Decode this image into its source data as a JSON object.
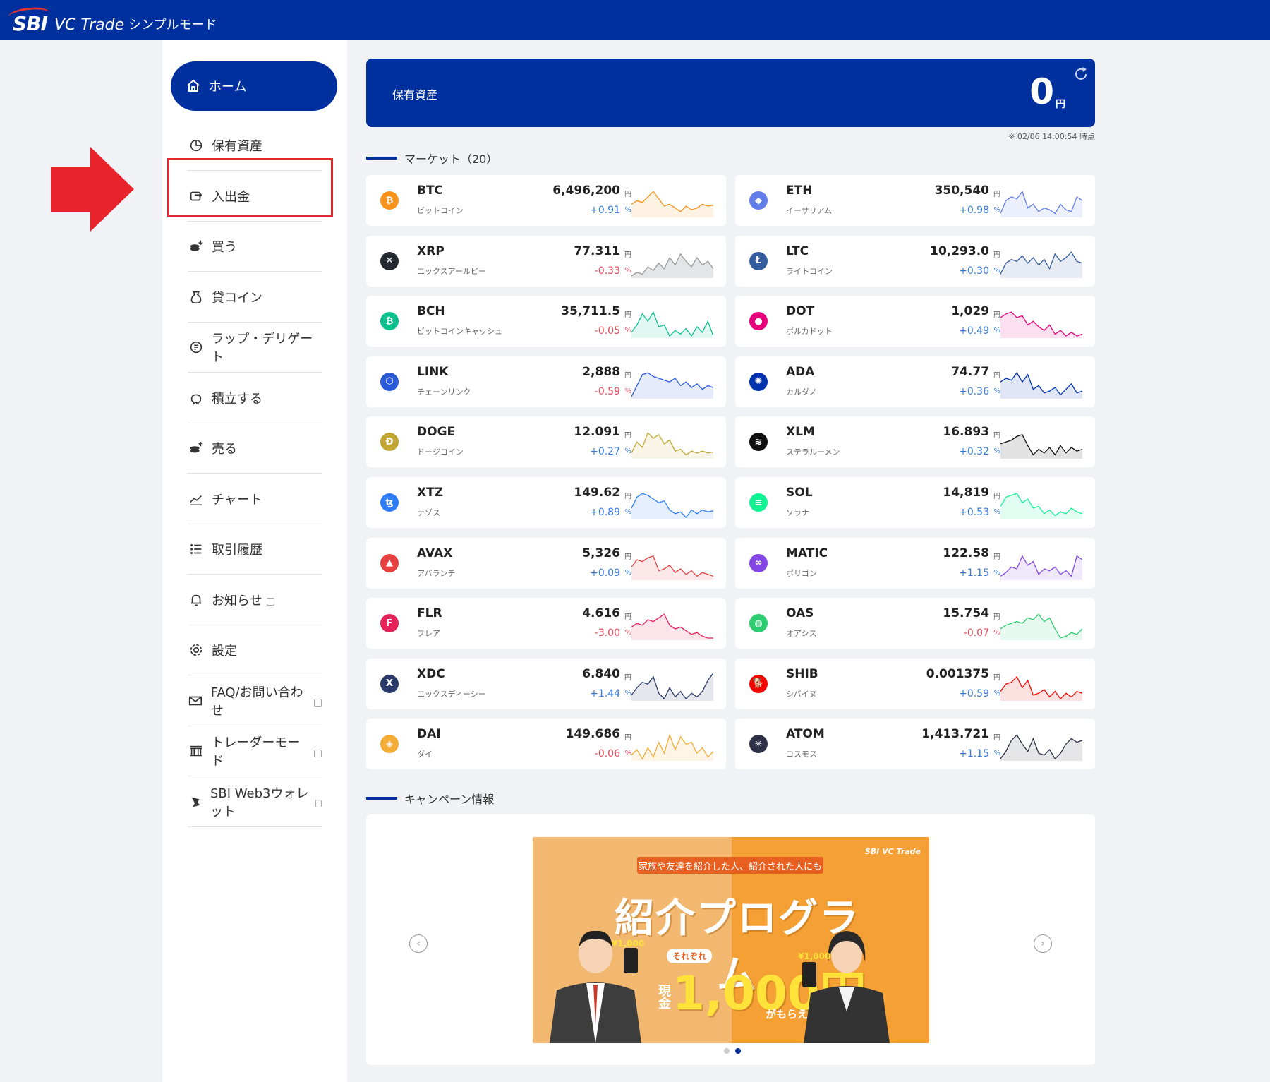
{
  "header": {
    "logo_sbi": "SBI",
    "logo_vc": "VC Trade",
    "mode": "シンプルモード"
  },
  "nav": {
    "home": "ホーム",
    "items": [
      {
        "label": "保有資産",
        "icon": "pie-chart-icon",
        "external": false
      },
      {
        "label": "入出金",
        "icon": "transfer-icon",
        "external": false
      },
      {
        "label": "買う",
        "icon": "buy-coins-icon",
        "external": false
      },
      {
        "label": "貸コイン",
        "icon": "money-bag-icon",
        "external": false
      },
      {
        "label": "ラップ・デリゲート",
        "icon": "wrap-icon",
        "external": false
      },
      {
        "label": "積立する",
        "icon": "piggy-bank-icon",
        "external": false
      },
      {
        "label": "売る",
        "icon": "sell-coins-icon",
        "external": false
      },
      {
        "label": "チャート",
        "icon": "line-chart-icon",
        "external": false
      },
      {
        "label": "取引履歴",
        "icon": "list-icon",
        "external": false
      },
      {
        "label": "お知らせ",
        "icon": "bell-icon",
        "external": true
      },
      {
        "label": "設定",
        "icon": "gear-icon",
        "external": false
      },
      {
        "label": "FAQ/お問い合わせ",
        "icon": "mail-icon",
        "external": true
      },
      {
        "label": "トレーダーモード",
        "icon": "bank-icon",
        "external": true
      },
      {
        "label": "SBI Web3ウォレット",
        "icon": "wallet-icon",
        "external": true
      }
    ]
  },
  "assets": {
    "label": "保有資産",
    "value": "0",
    "unit": "円",
    "timestamp": "※ 02/06 14:00:54 時点"
  },
  "market": {
    "title": "マーケット（20）"
  },
  "coins": [
    {
      "sym": "BTC",
      "name": "ビットコイン",
      "price": "6,496,200",
      "chg": "+0.91",
      "dir": "up",
      "color": "#f7931a",
      "glyph": "₿",
      "spark": [
        18,
        14,
        16,
        10,
        4,
        12,
        20,
        18,
        22,
        26,
        20,
        24,
        22,
        18,
        20,
        19
      ]
    },
    {
      "sym": "ETH",
      "name": "イーサリアム",
      "price": "350,540",
      "chg": "+0.98",
      "dir": "up",
      "color": "#627eea",
      "glyph": "◆",
      "spark": [
        28,
        14,
        10,
        12,
        4,
        22,
        18,
        26,
        22,
        24,
        28,
        18,
        24,
        26,
        10,
        14
      ]
    },
    {
      "sym": "XRP",
      "name": "エックスアールピー",
      "price": "77.311",
      "chg": "-0.33",
      "dir": "down",
      "color": "#23292f",
      "glyph": "✕",
      "spark": [
        30,
        26,
        28,
        20,
        24,
        16,
        22,
        10,
        18,
        6,
        14,
        20,
        10,
        18,
        14,
        22
      ]
    },
    {
      "sym": "LTC",
      "name": "ライトコイン",
      "price": "10,293.0",
      "chg": "+0.30",
      "dir": "up",
      "color": "#345d9d",
      "glyph": "Ł",
      "spark": [
        28,
        16,
        12,
        14,
        8,
        16,
        10,
        18,
        12,
        22,
        6,
        14,
        10,
        4,
        14,
        16
      ]
    },
    {
      "sym": "BCH",
      "name": "ビットコインキャッシュ",
      "price": "35,711.5",
      "chg": "-0.05",
      "dir": "down",
      "color": "#0ac18e",
      "glyph": "₿",
      "spark": [
        26,
        18,
        6,
        14,
        4,
        20,
        18,
        30,
        24,
        28,
        22,
        30,
        20,
        26,
        14,
        30
      ]
    },
    {
      "sym": "DOT",
      "name": "ポルカドット",
      "price": "1,029",
      "chg": "+0.49",
      "dir": "up",
      "color": "#e6007a",
      "glyph": "●",
      "spark": [
        10,
        6,
        4,
        10,
        8,
        18,
        14,
        20,
        24,
        18,
        28,
        24,
        30,
        26,
        30,
        28
      ]
    },
    {
      "sym": "LINK",
      "name": "チェーンリンク",
      "price": "2,888",
      "chg": "-0.59",
      "dir": "down",
      "color": "#2a5ada",
      "glyph": "⬡",
      "spark": [
        30,
        18,
        6,
        4,
        8,
        10,
        12,
        14,
        10,
        18,
        14,
        20,
        16,
        22,
        18,
        20
      ]
    },
    {
      "sym": "ADA",
      "name": "カルダノ",
      "price": "74.77",
      "chg": "+0.36",
      "dir": "up",
      "color": "#0033ad",
      "glyph": "✺",
      "spark": [
        14,
        10,
        12,
        4,
        14,
        6,
        22,
        18,
        26,
        24,
        20,
        28,
        22,
        16,
        26,
        24
      ]
    },
    {
      "sym": "DOGE",
      "name": "ドージコイン",
      "price": "12.091",
      "chg": "+0.27",
      "dir": "up",
      "color": "#c2a633",
      "glyph": "Ð",
      "spark": [
        26,
        14,
        20,
        4,
        10,
        6,
        16,
        12,
        24,
        22,
        28,
        24,
        26,
        24,
        26,
        25
      ]
    },
    {
      "sym": "XLM",
      "name": "ステラルーメン",
      "price": "16.893",
      "chg": "+0.32",
      "dir": "up",
      "color": "#111111",
      "glyph": "≋",
      "spark": [
        16,
        14,
        12,
        8,
        6,
        18,
        28,
        22,
        26,
        20,
        28,
        18,
        26,
        20,
        24,
        22
      ]
    },
    {
      "sym": "XTZ",
      "name": "テゾス",
      "price": "149.62",
      "chg": "+0.89",
      "dir": "up",
      "color": "#2c7df7",
      "glyph": "ꜩ",
      "spark": [
        20,
        8,
        4,
        6,
        10,
        14,
        12,
        22,
        26,
        24,
        30,
        22,
        26,
        22,
        24,
        23
      ]
    },
    {
      "sym": "SOL",
      "name": "ソラナ",
      "price": "14,819",
      "chg": "+0.53",
      "dir": "up",
      "color": "#14f195",
      "glyph": "≡",
      "spark": [
        18,
        8,
        6,
        4,
        14,
        10,
        20,
        18,
        26,
        22,
        28,
        24,
        26,
        20,
        24,
        26
      ]
    },
    {
      "sym": "AVAX",
      "name": "アバランチ",
      "price": "5,326",
      "chg": "+0.09",
      "dir": "up",
      "color": "#e84142",
      "glyph": "▲",
      "spark": [
        18,
        10,
        12,
        8,
        6,
        22,
        20,
        16,
        24,
        20,
        26,
        22,
        28,
        24,
        26,
        28
      ]
    },
    {
      "sym": "MATIC",
      "name": "ポリゴン",
      "price": "122.58",
      "chg": "+1.15",
      "dir": "up",
      "color": "#8247e5",
      "glyph": "∞",
      "spark": [
        28,
        24,
        18,
        20,
        6,
        16,
        12,
        26,
        20,
        22,
        18,
        26,
        22,
        28,
        6,
        10
      ]
    },
    {
      "sym": "FLR",
      "name": "フレア",
      "price": "4.616",
      "chg": "-3.00",
      "dir": "down",
      "color": "#e62058",
      "glyph": "F",
      "spark": [
        18,
        14,
        16,
        10,
        12,
        8,
        4,
        16,
        20,
        18,
        22,
        26,
        24,
        28,
        30,
        30
      ]
    },
    {
      "sym": "OAS",
      "name": "オアシス",
      "price": "15.754",
      "chg": "-0.07",
      "dir": "down",
      "color": "#2ecc71",
      "glyph": "◍",
      "spark": [
        20,
        16,
        14,
        12,
        14,
        8,
        10,
        4,
        12,
        8,
        20,
        30,
        28,
        24,
        26,
        20
      ]
    },
    {
      "sym": "XDC",
      "name": "エックスディーシー",
      "price": "6.840",
      "chg": "+1.44",
      "dir": "up",
      "color": "#2a3a6a",
      "glyph": "X",
      "spark": [
        26,
        18,
        12,
        14,
        6,
        24,
        30,
        18,
        28,
        22,
        30,
        24,
        28,
        22,
        10,
        2
      ]
    },
    {
      "sym": "SHIB",
      "name": "シバイヌ",
      "price": "0.001375",
      "chg": "+0.59",
      "dir": "up",
      "color": "#f00500",
      "glyph": "🐕",
      "spark": [
        22,
        14,
        12,
        6,
        18,
        10,
        26,
        24,
        20,
        28,
        22,
        30,
        24,
        28,
        22,
        24
      ]
    },
    {
      "sym": "DAI",
      "name": "ダイ",
      "price": "149.686",
      "chg": "-0.06",
      "dir": "down",
      "color": "#f5ac37",
      "glyph": "◈",
      "spark": [
        26,
        20,
        30,
        18,
        28,
        12,
        24,
        4,
        20,
        6,
        14,
        12,
        24,
        18,
        28,
        22
      ]
    },
    {
      "sym": "ATOM",
      "name": "コスモス",
      "price": "1,413.721",
      "chg": "+1.15",
      "dir": "up",
      "color": "#2e3148",
      "glyph": "✳",
      "spark": [
        30,
        22,
        10,
        4,
        14,
        22,
        8,
        24,
        26,
        20,
        30,
        24,
        14,
        8,
        12,
        10
      ]
    }
  ],
  "campaign": {
    "title": "キャンペーン情報",
    "tag": "家族や友達を紹介した人、紹介された人にも",
    "logo": "SBI VC Trade",
    "headline": "紹介プログラム",
    "each": "それぞれ",
    "cash": "現金",
    "amount": "1,000円",
    "end": "がもらえる",
    "badge": "¥1,000",
    "prev": "‹",
    "next": "›"
  },
  "colors": {
    "brand": "#002f9e",
    "highlight": "#e5262c",
    "up": "#3b7bd6",
    "down": "#e04a5a"
  }
}
